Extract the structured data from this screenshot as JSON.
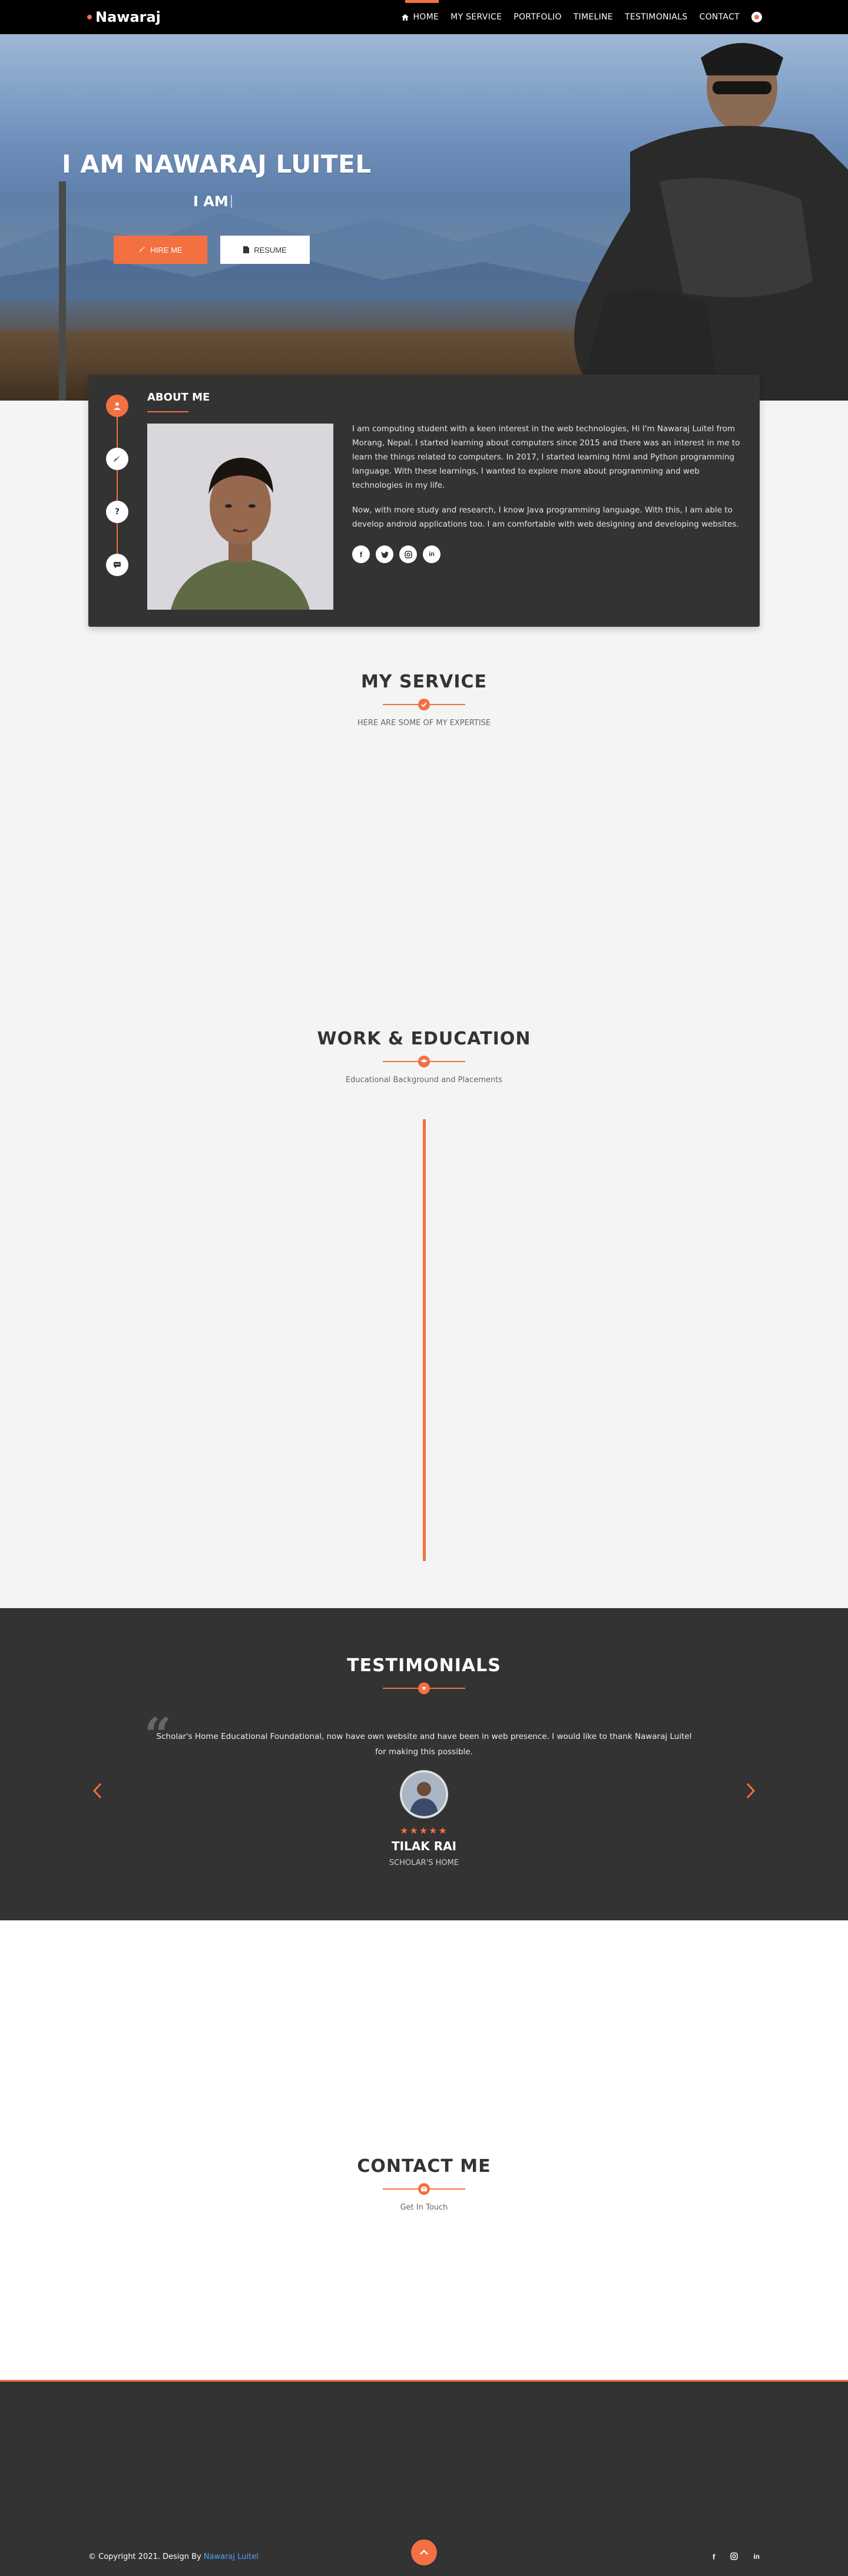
{
  "nav": {
    "brand": "Nawaraj",
    "links": [
      "HOME",
      "MY SERVICE",
      "PORTFOLIO",
      "TIMELINE",
      "TESTIMONIALS",
      "CONTACT"
    ]
  },
  "hero": {
    "title": "I AM NAWARAJ LUITEL",
    "subtitle": "I AM",
    "hire_label": "HIRE ME",
    "resume_label": "RESUME"
  },
  "about": {
    "title": "ABOUT ME",
    "para1": "I am computing student with a keen interest in the web technologies, Hi I'm Nawaraj Luitel from Morang, Nepal. I started learning about computers since 2015 and there was an interest in me to learn the things related to computers. In 2017, I started learning html and Python programming language. With these learnings, I wanted to explore more about programming and web technologies in my life.",
    "para2": "Now, with more study and research, I know Java programming language. With this, I am able to develop android applications too. I am comfortable with web designing and developing websites."
  },
  "service": {
    "title": "MY SERVICE",
    "subtitle": "HERE ARE SOME OF MY EXPERTISE"
  },
  "work": {
    "title": "WORK & EDUCATION",
    "subtitle": "Educational Background and Placements"
  },
  "testimonials": {
    "title": "TESTIMONIALS",
    "quote": "Scholar's Home Educational Foundational, now have own website and have been in web presence. I would like to thank Nawaraj Luitel for making this possible.",
    "stars": "★★★★★",
    "name": "TILAK RAI",
    "company": "SCHOLAR'S HOME"
  },
  "contact": {
    "title": "CONTACT ME",
    "subtitle": "Get In Touch"
  },
  "footer": {
    "copyright_prefix": "© Copyright 2021. Design By ",
    "author": "Nawaraj Luitel"
  },
  "colors": {
    "accent": "#f37041",
    "dark": "#333333",
    "link": "#4da3ff"
  }
}
